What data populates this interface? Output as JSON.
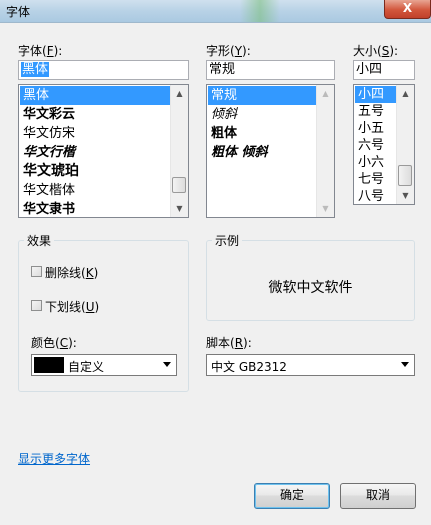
{
  "window": {
    "title": "字体",
    "close_label": "X"
  },
  "font_name": {
    "label": "字体(",
    "label_key": "F",
    "label_end": "):",
    "value": "黑体",
    "items": [
      "黑体",
      "华文彩云",
      "华文仿宋",
      "华文行楷",
      "华文琥珀",
      "华文楷体",
      "华文隶书"
    ],
    "selected_index": 0
  },
  "font_style": {
    "label": "字形(",
    "label_key": "Y",
    "label_end": "):",
    "value": "常规",
    "items": [
      "常规",
      "倾斜",
      "粗体",
      "粗体 倾斜"
    ],
    "selected_index": 0
  },
  "font_size": {
    "label": "大小(",
    "label_key": "S",
    "label_end": "):",
    "value": "小四",
    "items": [
      "小四",
      "五号",
      "小五",
      "六号",
      "小六",
      "七号",
      "八号"
    ],
    "selected_index": 0
  },
  "effects": {
    "group_label": "效果",
    "strikeout_label": "删除线(",
    "strikeout_key": "K",
    "strikeout_checked": false,
    "underline_label": "下划线(",
    "underline_key": "U",
    "underline_checked": false,
    "color_label": "颜色(",
    "color_key": "C",
    "color_value": "自定义",
    "color_swatch": "#000000"
  },
  "sample": {
    "group_label": "示例",
    "text": "微软中文软件"
  },
  "script": {
    "label": "脚本(",
    "label_key": "R",
    "label_end": "):",
    "value": "中文 GB2312"
  },
  "more_fonts_link": "显示更多字体",
  "buttons": {
    "ok": "确定",
    "cancel": "取消"
  },
  "colors": {
    "selection": "#3399ff",
    "link": "#0066cc",
    "titlebar": "#b8d2e6"
  }
}
